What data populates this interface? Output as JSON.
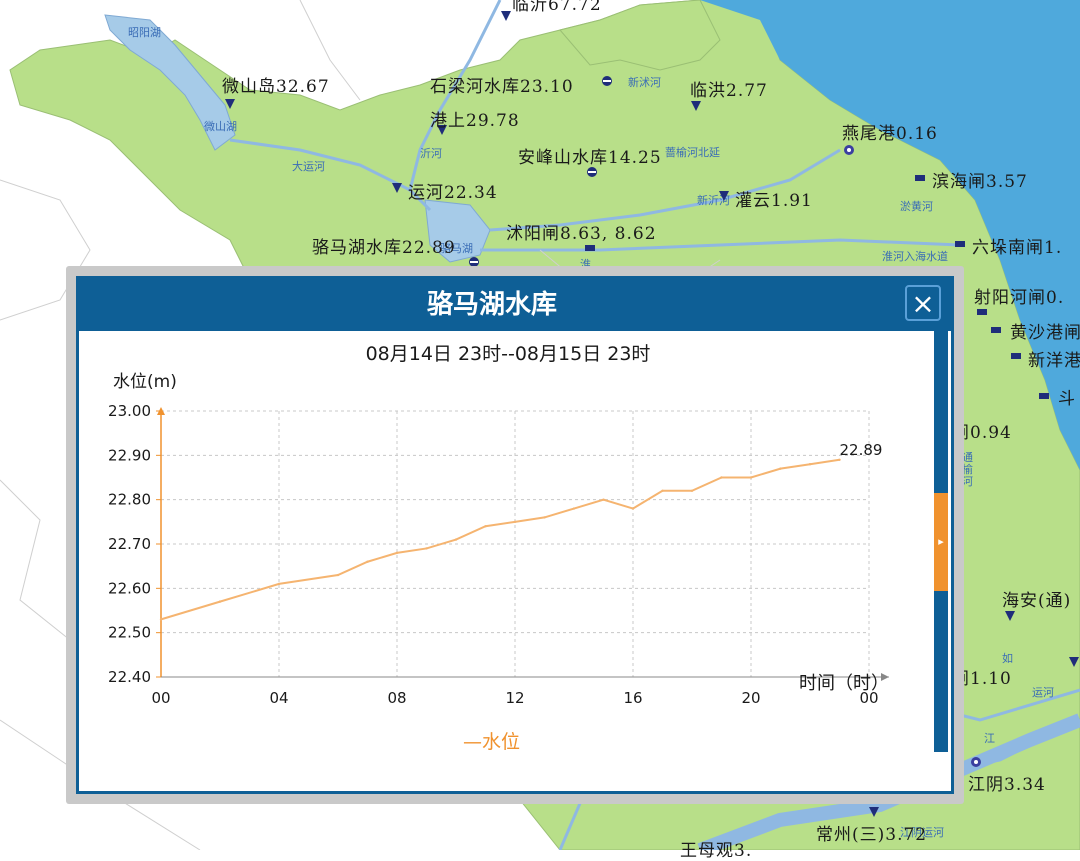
{
  "map": {
    "colors": {
      "sea": "#4fa9dc",
      "land": "#b8df89",
      "outside": "#ffffff",
      "lake": "#a6cbe8",
      "river": "#8fb8e2"
    },
    "water_labels": [
      "昭阳湖",
      "微山湖",
      "大运河",
      "沂河",
      "新沭河",
      "蔷榆河北延",
      "新沂河",
      "淤黄河",
      "淮河入海水道",
      "淮",
      "骆马湖",
      "通榆河",
      "如",
      "运河",
      "江",
      "江阴运河"
    ],
    "stations": [
      {
        "label": "微山岛32.67",
        "icon": "station-triangle-icon"
      },
      {
        "label": "石梁河水库23.10",
        "icon": "reservoir-icon"
      },
      {
        "label": "临洪2.77",
        "icon": "station-triangle-icon"
      },
      {
        "label": "港上29.78",
        "icon": "station-triangle-icon"
      },
      {
        "label": "安峰山水库14.25",
        "icon": "reservoir-icon"
      },
      {
        "label": "燕尾港0.16",
        "icon": "tide-station-icon"
      },
      {
        "label": "滨海闸3.57",
        "icon": "sluice-icon"
      },
      {
        "label": "运河22.34",
        "icon": "station-triangle-icon"
      },
      {
        "label": "灌云1.91",
        "icon": "station-triangle-icon"
      },
      {
        "label": "沭阳闸8.63, 8.62",
        "icon": "sluice-icon"
      },
      {
        "label": "骆马湖水库22.89",
        "icon": "reservoir-icon"
      },
      {
        "label": "六垛南闸1.",
        "icon": "sluice-icon"
      },
      {
        "label": "射阳河闸0.",
        "icon": "sluice-icon"
      },
      {
        "label": "黄沙港闸",
        "icon": "sluice-icon"
      },
      {
        "label": "新洋港",
        "icon": "sluice-icon"
      },
      {
        "label": "斗",
        "icon": "sluice-icon"
      },
      {
        "label": "闸0.94",
        "icon": "sluice-icon"
      },
      {
        "label": "海安(通)",
        "icon": "station-triangle-icon"
      },
      {
        "label": "闸1.10",
        "icon": "sluice-icon"
      },
      {
        "label": "江阴3.34",
        "icon": "tide-station-icon"
      },
      {
        "label": "常州(三)3.72",
        "icon": "station-triangle-icon"
      },
      {
        "label": "王母观3.",
        "icon": "station-triangle-icon"
      },
      {
        "label": "临沂67.72",
        "icon": "station-triangle-icon"
      }
    ]
  },
  "popup": {
    "title": "骆马湖水库",
    "close_label": "×",
    "subtitle": "08月14日 23时--08月15日 23时",
    "header_color": "#0e5f96",
    "side_toggle_color": "#f0922e",
    "side_toggle_label": "▸"
  },
  "chart_data": {
    "type": "line",
    "title": "",
    "ylabel": "水位(m)",
    "xlabel": "时间（时）",
    "ylim": [
      22.4,
      23.0
    ],
    "yticks": [
      "22.40",
      "22.50",
      "22.60",
      "22.70",
      "22.80",
      "22.90",
      "23.00"
    ],
    "xticks": [
      "00",
      "04",
      "08",
      "12",
      "16",
      "20",
      "00"
    ],
    "grid": true,
    "legend_position": "bottom",
    "series": [
      {
        "name": "水位",
        "color": "#f5b470",
        "x": [
          0,
          2,
          4,
          6,
          7,
          8,
          9,
          10,
          11,
          12,
          13,
          14,
          15,
          16,
          17,
          18,
          19,
          20,
          21,
          22,
          23
        ],
        "values": [
          22.53,
          22.57,
          22.61,
          22.63,
          22.66,
          22.68,
          22.69,
          22.71,
          22.74,
          22.75,
          22.76,
          22.78,
          22.8,
          22.78,
          22.82,
          22.82,
          22.85,
          22.85,
          22.87,
          22.88,
          22.89
        ]
      }
    ],
    "annotations": [
      "22.89"
    ]
  }
}
